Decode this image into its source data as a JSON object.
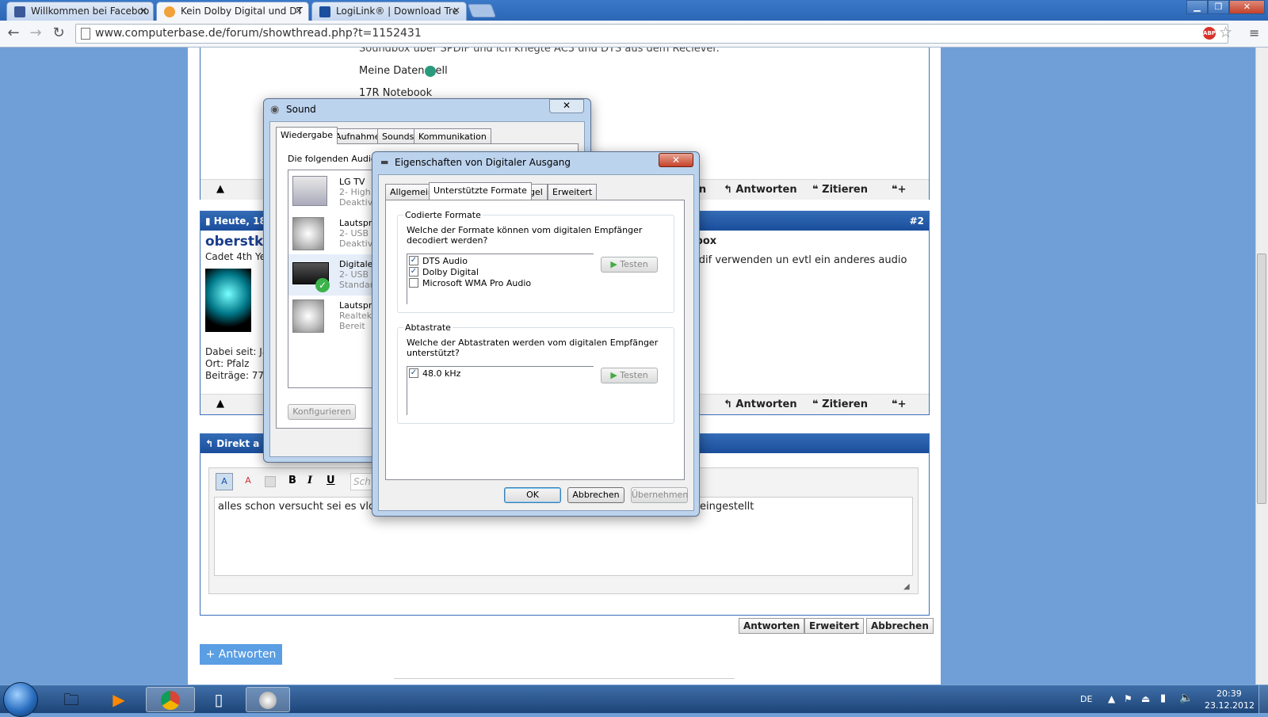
{
  "browser": {
    "tabs": [
      {
        "label": "Willkommen bei Faceboo"
      },
      {
        "label": "Kein Dolby Digital und DT"
      },
      {
        "label": "LogiLink® | Download Tre"
      }
    ],
    "url": "www.computerbase.de/forum/showthread.php?t=1152431",
    "abp_label": "ABP"
  },
  "post1": {
    "line1": "Soundbox über SPDIF und ich kriegte AC3 und DTS aus dem Reciever.",
    "line2": "Meine Daten",
    "line2b": "ell",
    "line3": "17R Notebook",
    "actions": {
      "reply": "Antworten",
      "quote": "Zitieren",
      "partial": "en"
    }
  },
  "post2": {
    "date": "Heute, 18:",
    "number": "#2",
    "username": "oberstkl",
    "rank": "Cadet 4th Ye",
    "joined": "Dabei seit: Ja",
    "location": "Ort: Pfalz",
    "posts": "Beiträge: 77",
    "title_partial": "ndbox",
    "text_partial": "i spdif verwenden un evtl ein anderes audio",
    "actions": {
      "reply": "Antworten",
      "quote": "Zitieren"
    }
  },
  "quickreply": {
    "header": "Direkt a",
    "editor_text": "alles schon versucht sei es vlc,",
    "editor_text2": "eingestellt",
    "font_placeholder": "Sch",
    "buttons": {
      "reply": "Antworten",
      "advanced": "Erweitert",
      "cancel": "Abbrechen"
    },
    "reply_big": "+ Antworten"
  },
  "sound_dialog": {
    "title": "Sound",
    "tabs": [
      "Wiedergabe",
      "Aufnahme",
      "Sounds",
      "Kommunikation"
    ],
    "intro": "Die folgenden Audio",
    "devices": [
      {
        "name": "LG TV",
        "line2": "2- High",
        "line3": "Deaktiv"
      },
      {
        "name": "Lautspre",
        "line2": "2- USB N",
        "line3": "Deaktiv"
      },
      {
        "name": "Digitaler",
        "line2": "2- USB N",
        "line3": "Standar"
      },
      {
        "name": "Lautspre",
        "line2": "Realtek",
        "line3": "Bereit"
      }
    ],
    "configure": "Konfigurieren"
  },
  "props_dialog": {
    "title": "Eigenschaften von Digitaler Ausgang",
    "tabs": [
      "Allgemein",
      "Unterstützte Formate",
      "Pegel",
      "Erweitert"
    ],
    "encoded": {
      "label": "Codierte Formate",
      "question": "Welche der Formate können vom digitalen Empfänger decodiert werden?",
      "items": [
        {
          "label": "DTS Audio",
          "checked": "✓"
        },
        {
          "label": "Dolby Digital",
          "checked": "✓"
        },
        {
          "label": "Microsoft WMA Pro Audio",
          "checked": ""
        }
      ],
      "test": "Testen"
    },
    "rate": {
      "label": "Abtastrate",
      "question": "Welche der Abtastraten werden vom digitalen Empfänger unterstützt?",
      "items": [
        {
          "label": "48.0 kHz",
          "checked": "✓"
        }
      ],
      "test": "Testen"
    },
    "buttons": {
      "ok": "OK",
      "cancel": "Abbrechen",
      "apply": "Übernehmen"
    }
  },
  "taskbar": {
    "lang": "DE",
    "time": "20:39",
    "date": "23.12.2012"
  }
}
